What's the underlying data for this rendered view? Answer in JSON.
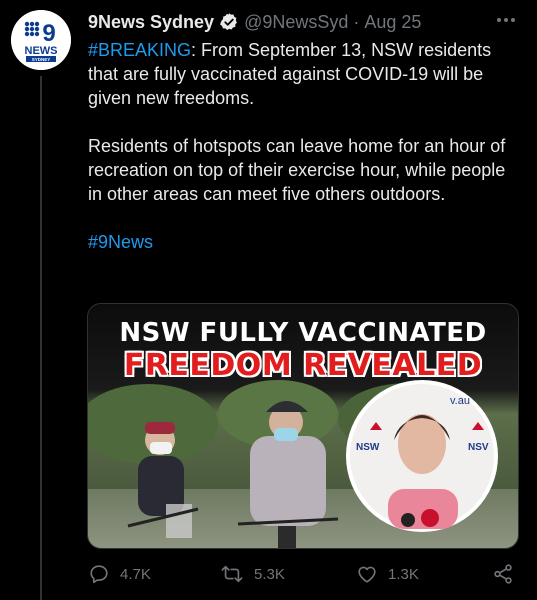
{
  "tweet": {
    "author_name": "9News Sydney",
    "handle": "@9NewsSyd",
    "separator": "·",
    "time": "Aug 25",
    "avatar": {
      "logo_number": "9",
      "logo_word": "NEWS",
      "logo_sub": "SYDNEY"
    },
    "text": {
      "hashtag_breaking": "#BREAKING",
      "para1_rest": ": From September 13, NSW residents that are fully vaccinated against COVID-19 will be given new freedoms.",
      "para2": "Residents of hotspots can leave home for an hour of recreation on top of their exercise hour, while people in other areas can meet five others outdoors.",
      "hashtag_9news": "#9News"
    },
    "media": {
      "headline_line1": "NSW FULLY VACCINATED",
      "headline_line2": "FREEDOM REVEALED",
      "background_sign_text": "v.au",
      "podium_left": "NSW",
      "podium_right": "NSV"
    },
    "actions": {
      "reply_count": "4.7K",
      "retweet_count": "5.3K",
      "like_count": "1.3K"
    }
  },
  "colors": {
    "background": "#000000",
    "text": "#e7e9ea",
    "muted": "#71767b",
    "link": "#1d9bf0",
    "verified": "#e7e9ea",
    "headline_red": "#e11d1d",
    "brand_blue": "#0a3d8f"
  },
  "icons": [
    "verified-badge-icon",
    "more-icon",
    "reply-icon",
    "retweet-icon",
    "like-icon",
    "share-icon"
  ]
}
